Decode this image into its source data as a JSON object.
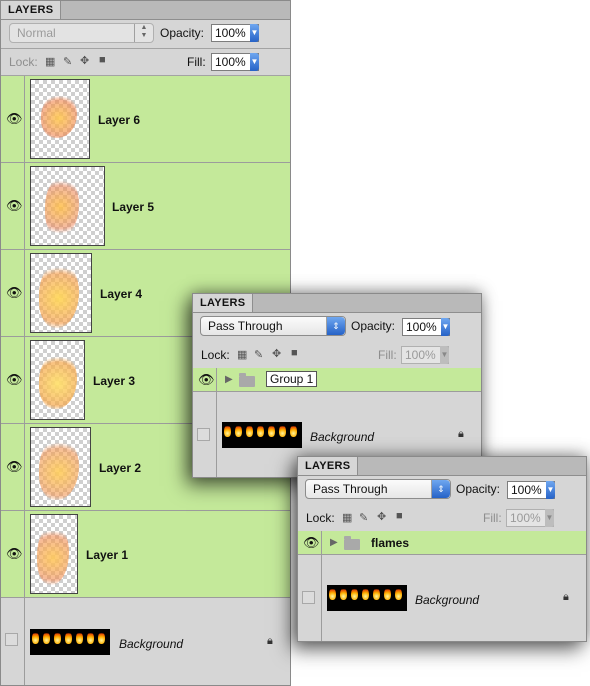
{
  "panel_main": {
    "tab": "LAYERS",
    "blend_mode": "Normal",
    "opacity_label": "Opacity:",
    "opacity_value": "100%",
    "lock_label": "Lock:",
    "fill_label": "Fill:",
    "fill_value": "100%",
    "layers": [
      {
        "name": "Layer 6",
        "visible": true
      },
      {
        "name": "Layer 5",
        "visible": true
      },
      {
        "name": "Layer 4",
        "visible": true
      },
      {
        "name": "Layer 3",
        "visible": true
      },
      {
        "name": "Layer 2",
        "visible": true
      },
      {
        "name": "Layer 1",
        "visible": true
      }
    ],
    "background": {
      "name": "Background",
      "visible": false,
      "locked": true
    }
  },
  "panel_group": {
    "tab": "LAYERS",
    "blend_mode": "Pass Through",
    "opacity_label": "Opacity:",
    "opacity_value": "100%",
    "lock_label": "Lock:",
    "fill_label": "Fill:",
    "fill_value": "100%",
    "group_name": "Group 1",
    "background": {
      "name": "Background",
      "visible": false,
      "locked": true
    }
  },
  "panel_flames": {
    "tab": "LAYERS",
    "blend_mode": "Pass Through",
    "opacity_label": "Opacity:",
    "opacity_value": "100%",
    "lock_label": "Lock:",
    "fill_label": "Fill:",
    "fill_value": "100%",
    "group_name": "flames",
    "background": {
      "name": "Background",
      "visible": false,
      "locked": true
    }
  },
  "colors": {
    "selected_row": "#c4e99a",
    "panel_bg": "#d6d6d6",
    "accent_blue": "#3a78dd"
  },
  "icons": [
    "eye-icon",
    "lock-transparent-icon",
    "lock-paint-icon",
    "lock-move-icon",
    "lock-all-icon",
    "padlock-icon",
    "disclosure-triangle-icon",
    "folder-icon"
  ]
}
